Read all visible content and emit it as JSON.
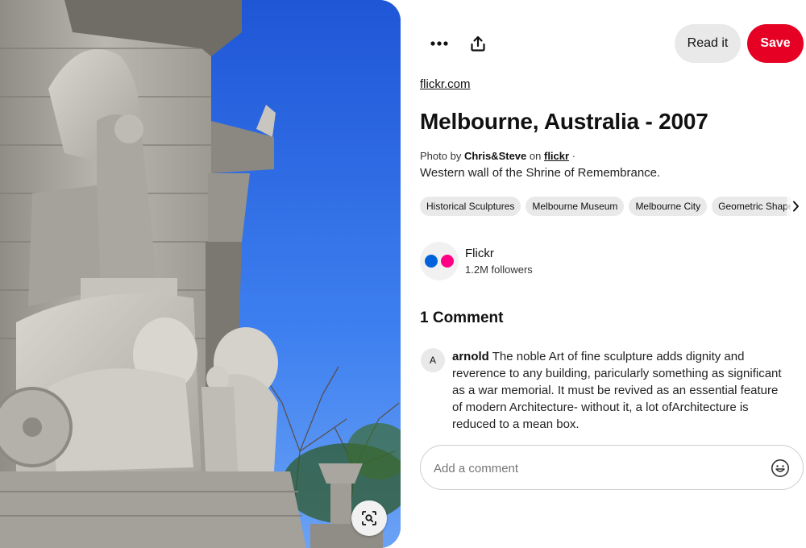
{
  "pin": {
    "image_alt": "Western wall of the Shrine of Remembrance sculpture with lions",
    "source_link": "flickr.com",
    "title": "Melbourne, Australia - 2007",
    "credit": {
      "prefix": "Photo by",
      "author": "Chris&Steve",
      "on": "on",
      "site": "flickr",
      "separator": "·"
    },
    "description": "Western wall of the Shrine of Remembrance."
  },
  "toolbar": {
    "more_icon": "more-horizontal-icon",
    "share_icon": "share-upload-icon",
    "read_label": "Read it",
    "save_label": "Save"
  },
  "tags": [
    "Historical Sculptures",
    "Melbourne Museum",
    "Melbourne City",
    "Geometric Shapes"
  ],
  "creator": {
    "name": "Flickr",
    "followers": "1.2M followers",
    "brand_colors": {
      "blue": "#0063dc",
      "pink": "#ff0084"
    }
  },
  "comments": {
    "heading": "1 Comment",
    "items": [
      {
        "avatar_letter": "A",
        "author": "arnold",
        "text": "The noble Art of fine sculpture adds dignity and reverence to any building, paricularly something as significant as a war memorial. It must be revived as an essential feature of modern Architecture- without it, a lot ofArchitecture is reduced to a mean box."
      }
    ],
    "input_placeholder": "Add a comment"
  },
  "colors": {
    "save_red": "#e60023",
    "chip_gray": "#e9e9e9",
    "sky_blue": "#2f6fe4"
  }
}
